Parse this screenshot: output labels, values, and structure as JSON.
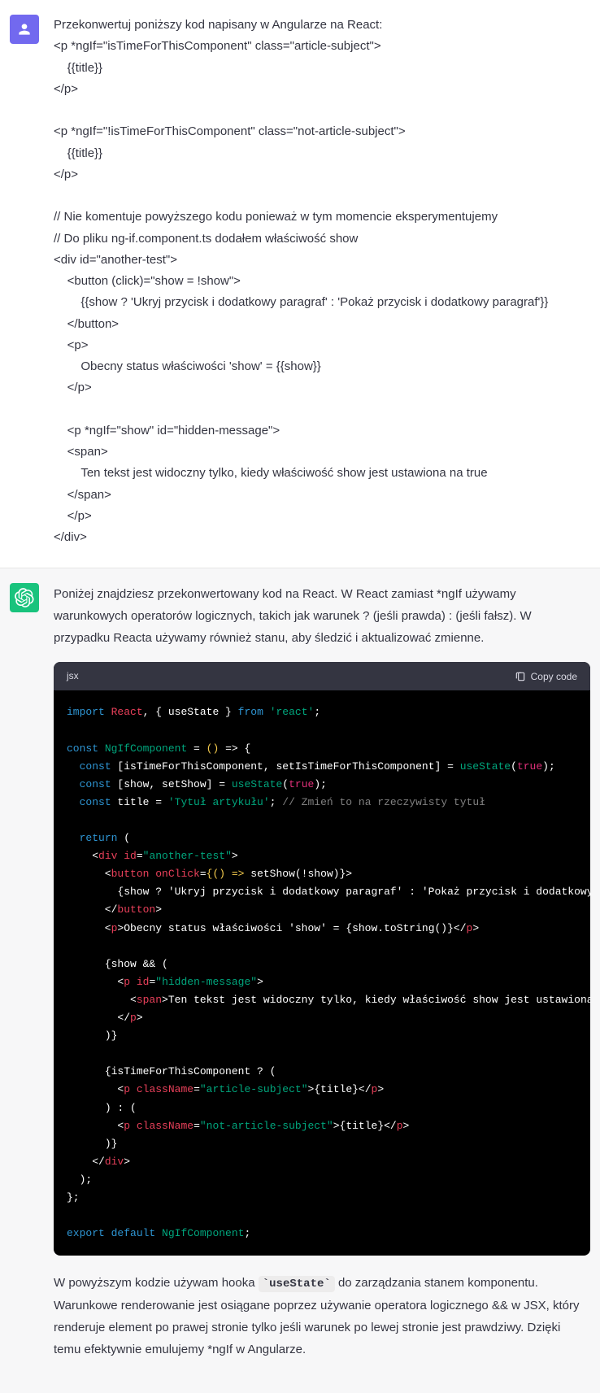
{
  "user_message": {
    "lines": [
      "Przekonwertuj poniższy kod napisany w Angularze na React:",
      "<p *ngIf=\"isTimeForThisComponent\" class=\"article-subject\">",
      "    {{title}}",
      "</p>",
      "",
      "<p *ngIf=\"!isTimeForThisComponent\" class=\"not-article-subject\">",
      "    {{title}}",
      "</p>",
      "",
      "// Nie komentuje powyższego kodu ponieważ w tym momencie eksperymentujemy",
      "// Do pliku ng-if.component.ts dodałem właściwość show",
      "<div id=\"another-test\">",
      "    <button (click)=\"show = !show\">",
      "        {{show ? 'Ukryj przycisk i dodatkowy paragraf' : 'Pokaż przycisk i dodatkowy paragraf'}}",
      "    </button>",
      "    <p>",
      "        Obecny status właściwości 'show' = {{show}}",
      "    </p>",
      "",
      "    <p *ngIf=\"show\" id=\"hidden-message\">",
      "    <span>",
      "        Ten tekst jest widoczny tylko, kiedy właściwość show jest ustawiona na true",
      "    </span>",
      "    </p>",
      "</div>"
    ]
  },
  "assistant": {
    "intro": "Poniżej znajdziesz przekonwertowany kod na React. W React zamiast *ngIf używamy warunkowych operatorów logicznych, takich jak warunek ? (jeśli prawda) : (jeśli fałsz). W przypadku Reacta używamy również stanu, aby śledzić i aktualizować zmienne.",
    "code_lang": "jsx",
    "copy_label": "Copy code",
    "outro_parts": {
      "before": "W powyższym kodzie używam hooka ",
      "code": "useState",
      "after": " do zarządzania stanem komponentu. Warunkowe renderowanie jest osiągane poprzez używanie operatora logicznego && w JSX, który renderuje element po prawej stronie tylko jeśli warunek po lewej stronie jest prawdziwy. Dzięki temu efektywnie emulujemy *ngIf w Angularze."
    }
  },
  "code": {
    "l1_import": "import",
    "l1_React": "React",
    "l1_rest": ", { useState } ",
    "l1_from": "from",
    "l1_react_str": "'react'",
    "l3_const": "const",
    "l3_name": "NgIfComponent",
    "l3_arrow_open": " = ",
    "l3_paren": "()",
    "l3_arrow": " =>",
    "l3_brace": " {",
    "l4_const": "const",
    "l4_destr": " [isTimeForThisComponent, setIsTimeForThisComponent] = ",
    "l4_useState": "useState",
    "l4_true": "true",
    "l5_const": "const",
    "l5_destr": " [show, setShow] = ",
    "l5_useState": "useState",
    "l5_true": "true",
    "l6_const": "const",
    "l6_title": " title = ",
    "l6_str": "'Tytuł artykułu'",
    "l6_comment": "// Zmień to na rzeczywisty tytuł",
    "l8_return": "return",
    "l9_div": "div",
    "l9_id": "id",
    "l9_idval": "\"another-test\"",
    "l10_button": "button",
    "l10_onClick": "onClick",
    "l10_handler": "{() =>",
    "l10_setShow": " setShow(!show)}",
    "l11_txt": "{show ? 'Ukryj przycisk i dodatkowy paragraf' : 'Pokaż przycisk i dodatkowy paragraf'}",
    "l12_button": "button",
    "l13_p": "p",
    "l13_txt": "Obecny status właściwości 'show' = {show.toString()}",
    "l15_cond": "{show && (",
    "l16_p": "p",
    "l16_id": "id",
    "l16_idval": "\"hidden-message\"",
    "l17_span": "span",
    "l17_txt": "Ten tekst jest widoczny tylko, kiedy właściwość show jest ustawiona na true",
    "l18_p": "p",
    "l19_close": ")}",
    "l21_cond": "{isTimeForThisComponent ? (",
    "l22_p": "p",
    "l22_cn": "className",
    "l22_cnval": "\"article-subject\"",
    "l22_title": "{title}",
    "l23_mid": ") : (",
    "l24_p": "p",
    "l24_cn": "className",
    "l24_cnval": "\"not-article-subject\"",
    "l24_title": "{title}",
    "l25_close": ")}",
    "l26_div": "div",
    "l29_export": "export",
    "l29_default": "default",
    "l29_name": "NgIfComponent"
  }
}
